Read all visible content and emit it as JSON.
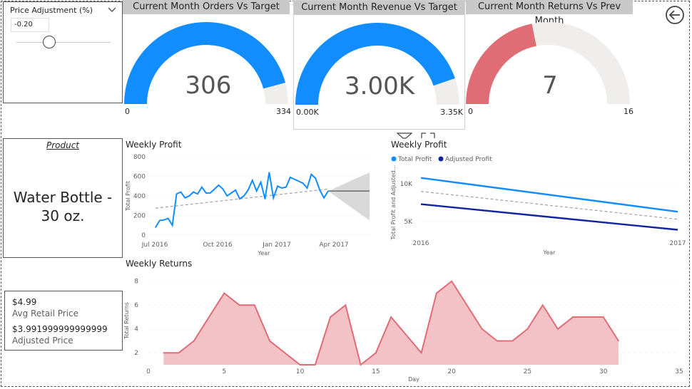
{
  "slicer": {
    "title": "Price Adjustment (%)",
    "value": "-0.20",
    "slider_position": 0.35
  },
  "gauges": [
    {
      "title": "Current Month Orders Vs Target",
      "value_label": "306",
      "min_label": "0",
      "max_label": "334",
      "value": 306,
      "max": 334,
      "color": "#118dff"
    },
    {
      "title": "Current Month Revenue Vs Target",
      "value_label": "3.00K",
      "min_label": "0.00K",
      "max_label": "3.35K",
      "value": 3000,
      "max": 3350,
      "color": "#118dff"
    },
    {
      "title": "Current Month Returns Vs Prev Month",
      "value_label": "7",
      "min_label": "0",
      "max_label": "16",
      "value": 7,
      "max": 16,
      "color": "#e06c75"
    }
  ],
  "product_card": {
    "header": "Product",
    "value_line1": "Water Bottle -",
    "value_line2": "30 oz."
  },
  "price_card": {
    "avg_retail_value": "$4.99",
    "avg_retail_label": "Avg Retail Price",
    "adjusted_value": "$3.991999999999999",
    "adjusted_label": "Adjusted Price"
  },
  "nav": {
    "back_icon": "back-arrow-icon"
  },
  "chart_data": [
    {
      "type": "line",
      "title": "Weekly Profit",
      "xlabel": "Year",
      "ylabel": "Total Profit",
      "x_ticks": [
        "Jul 2016",
        "Oct 2016",
        "Jan 2017",
        "Apr 2017"
      ],
      "y_ticks": [
        "0",
        "200",
        "400",
        "600",
        "800"
      ],
      "ylim": [
        0,
        800
      ],
      "series": [
        {
          "values": [
            80,
            150,
            155,
            170,
            100,
            420,
            440,
            380,
            400,
            440,
            420,
            490,
            430,
            430,
            470,
            510,
            470,
            400,
            430,
            460,
            370,
            400,
            460,
            560,
            450,
            540,
            370,
            640,
            380,
            500,
            480,
            490,
            590,
            570,
            550,
            530,
            480,
            620,
            580,
            460,
            380,
            450
          ]
        }
      ],
      "trend": [
        275,
        470
      ],
      "forecast": {
        "value": 450,
        "upper": 640,
        "lower": 150
      },
      "color": "#118dff",
      "forecast_color": "#6b6b6b",
      "band_color": "#d9d9d9"
    },
    {
      "type": "line",
      "title": "Weekly Profit",
      "legend": [
        "Total Profit",
        "Adjusted Profit"
      ],
      "legend_position": "top-left",
      "xlabel": "Year",
      "ylabel": "Total Profit and Adjusted...",
      "x_ticks": [
        "2016",
        "2017"
      ],
      "y_ticks": [
        "5K",
        "10K"
      ],
      "ylim": [
        3000,
        12000
      ],
      "series": [
        {
          "name": "Total Profit",
          "x": [
            "2016",
            "2017"
          ],
          "values": [
            10800,
            6300
          ],
          "color": "#118dff"
        },
        {
          "name": "Adjusted Profit",
          "x": [
            "2016",
            "2017"
          ],
          "values": [
            7300,
            3900
          ],
          "color": "#12239e"
        }
      ],
      "trend": [
        9000,
        5300
      ]
    },
    {
      "type": "area",
      "title": "Weekly Returns",
      "xlabel": "Day",
      "ylabel": "Total Returns",
      "x_ticks": [
        "0",
        "5",
        "10",
        "15",
        "20",
        "25",
        "30",
        "35"
      ],
      "y_ticks": [
        "2",
        "4",
        "6",
        "8"
      ],
      "xlim": [
        0,
        35
      ],
      "ylim": [
        1,
        8.4
      ],
      "x": [
        1,
        2,
        3,
        4,
        5,
        6,
        7,
        8,
        9,
        10,
        11,
        12,
        13,
        14,
        15,
        16,
        17,
        18,
        19,
        20,
        21,
        22,
        23,
        24,
        25,
        26,
        27,
        28,
        29,
        30,
        31
      ],
      "values": [
        2,
        2,
        3,
        5,
        7,
        6,
        6,
        3,
        2,
        1,
        1,
        5,
        6,
        1,
        2,
        5,
        3.5,
        2,
        7,
        8,
        6,
        4,
        3,
        3,
        4,
        6,
        4,
        5,
        5,
        5,
        3
      ],
      "color": "#e06c75",
      "fill_color": "#f3c2c6"
    }
  ]
}
